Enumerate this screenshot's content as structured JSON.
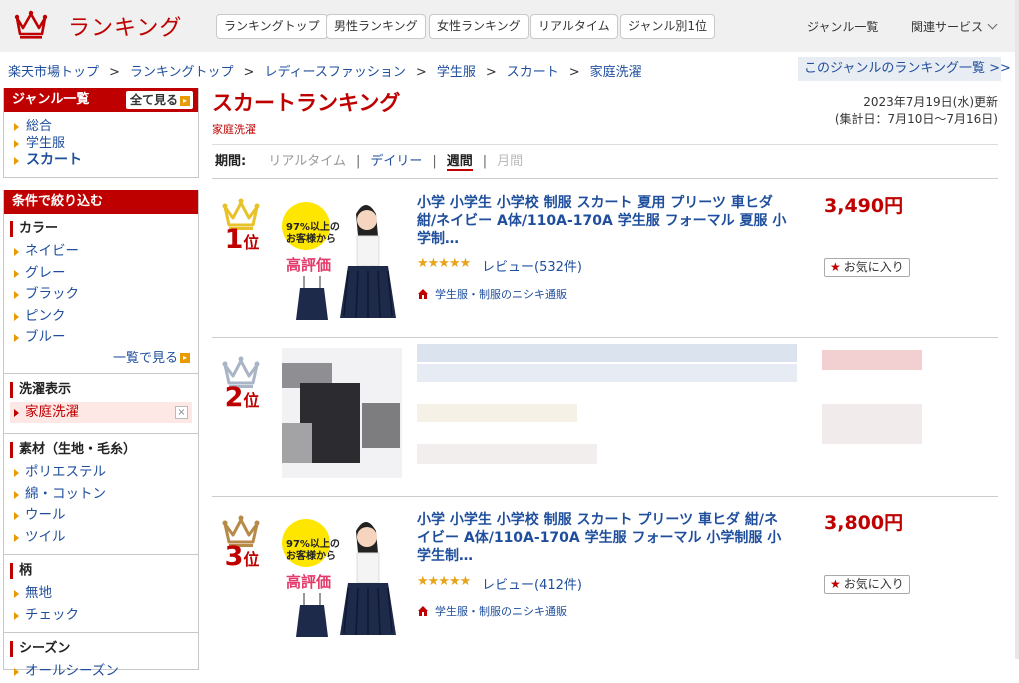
{
  "header": {
    "logo_label": "ランキング",
    "nav": [
      "ランキングトップ",
      "男性ランキング",
      "女性ランキング",
      "リアルタイム",
      "ジャンル別1位"
    ],
    "genre_list": "ジャンル一覧",
    "related_services": "関連サービス"
  },
  "breadcrumb": [
    "楽天市場トップ",
    "ランキングトップ",
    "レディースファッション",
    "学生服",
    "スカート",
    "家庭洗濯"
  ],
  "breadcrumb_sep": ">",
  "genre_ranking_link": "このジャンルのランキング一覧 >>",
  "sidebar": {
    "genre_title": "ジャンル一覧",
    "see_all": "全て見る",
    "genre_items": [
      "総合",
      "学生服",
      "スカート"
    ],
    "filter_title": "条件で絞り込む",
    "sections": [
      {
        "title": "カラー",
        "items": [
          "ネイビー",
          "グレー",
          "ブラック",
          "ピンク",
          "ブルー"
        ],
        "more": "一覧で見る"
      },
      {
        "title": "洗濯表示",
        "items": [
          "家庭洗濯"
        ],
        "active": "家庭洗濯"
      },
      {
        "title": "素材（生地・毛糸）",
        "items": [
          "ポリエステル",
          "綿・コットン",
          "ウール",
          "ツイル"
        ]
      },
      {
        "title": "柄",
        "items": [
          "無地",
          "チェック"
        ]
      },
      {
        "title": "シーズン",
        "items": [
          "オールシーズン"
        ]
      }
    ],
    "clear_icon": "×"
  },
  "main": {
    "title": "スカートランキング",
    "subtitle": "家庭洗濯",
    "update_date": "2023年7月19日(水)更新",
    "update_range": "(集計日：7月10日〜7月16日)",
    "period_label": "期間:",
    "periods": [
      "リアルタイム",
      "デイリー",
      "週間",
      "月間"
    ],
    "current_period": "週間",
    "rank_unit": "位",
    "products": [
      {
        "rank": "1",
        "crown_color": "#e8c22a",
        "title": "小学 小学生 小学校 制服 スカート 夏用 プリーツ 車ヒダ 紺/ネイビー A体/110A-170A 学生服 フォーマル 夏服 小学制…",
        "stars": "★★★★★",
        "review": "レビュー(532件)",
        "shop": "学生服・制服のニシキ通販",
        "price": "3,490円",
        "fav": "お気に入り",
        "badge_line1": "97%以上の",
        "badge_line2": "お客様から",
        "badge_line3": "高評価"
      },
      {
        "rank": "2",
        "crown_color": "#a9b4c6",
        "blurred": true
      },
      {
        "rank": "3",
        "crown_color": "#b88a4a",
        "title": "小学 小学生 小学校 制服 スカート プリーツ 車ヒダ 紺/ネイビー A体/110A-170A 学生服 フォーマル 小学制服 小学生制…",
        "stars": "★★★★★",
        "review": "レビュー(412件)",
        "shop": "学生服・制服のニシキ通販",
        "price": "3,800円",
        "fav": "お気に入り",
        "badge_line1": "97%以上の",
        "badge_line2": "お客様から",
        "badge_line3": "高評価"
      }
    ]
  },
  "colors": {
    "brand_red": "#bf0000",
    "link_blue": "#1f4e9c",
    "accent_orange": "#e89a00"
  }
}
